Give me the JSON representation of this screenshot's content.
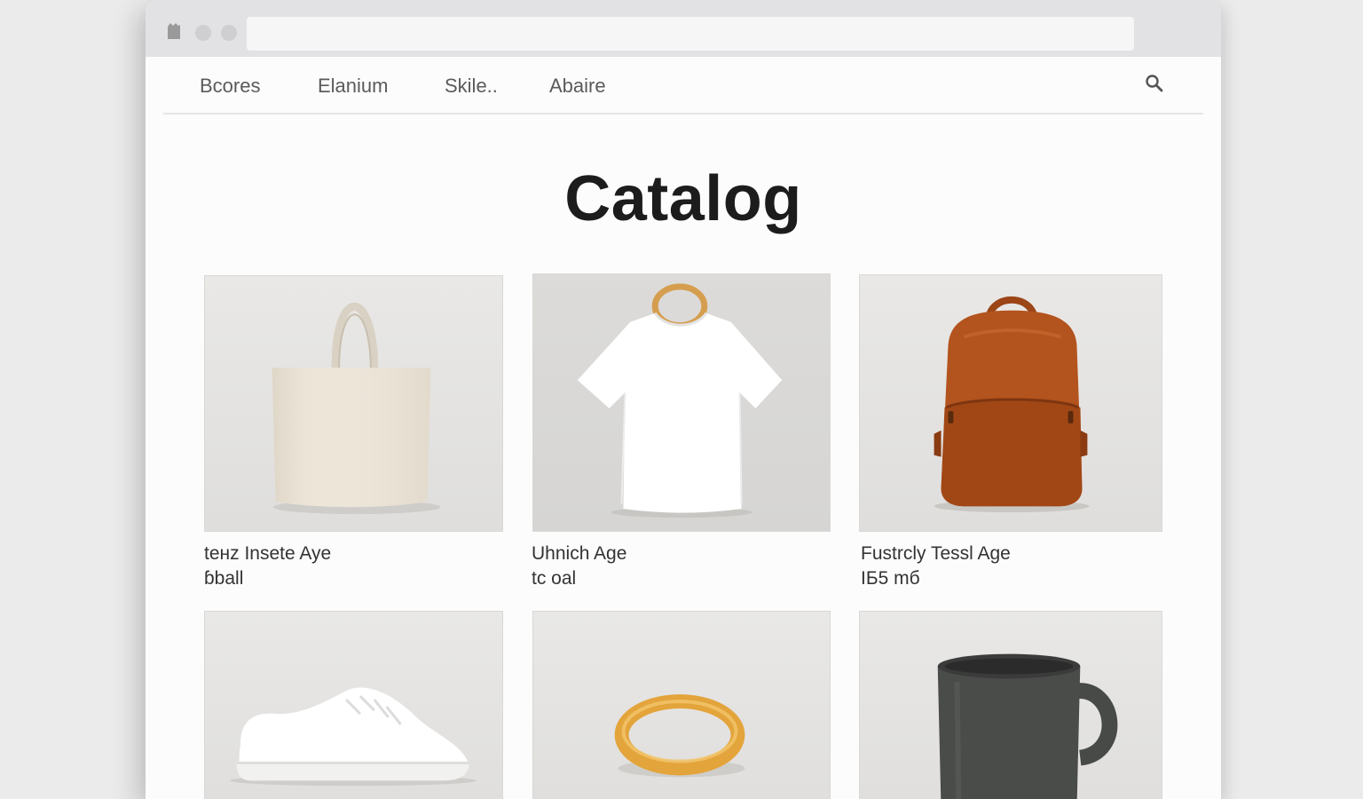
{
  "browser": {
    "address": ""
  },
  "nav": {
    "items": [
      "Bcores",
      "Elanium",
      "Skile..",
      "Abaire"
    ]
  },
  "page": {
    "title": "Catalog"
  },
  "products": [
    {
      "name": "teнz Insete Aye",
      "price": "ɓball",
      "image": "tote-bag-icon"
    },
    {
      "name": "Uhnich Age",
      "price": "tc oal",
      "image": "t-shirt-icon"
    },
    {
      "name": "Fustrcly Tessl Age",
      "price": "IБ5 mб",
      "image": "backpack-icon"
    },
    {
      "name": "",
      "price": "",
      "image": "sneaker-icon"
    },
    {
      "name": "",
      "price": "",
      "image": "bangle-icon"
    },
    {
      "name": "",
      "price": "",
      "image": "mug-icon"
    }
  ],
  "colors": {
    "accent_leather": "#b3531d",
    "accent_gold": "#e3a43b",
    "mug": "#4a4c4a"
  }
}
